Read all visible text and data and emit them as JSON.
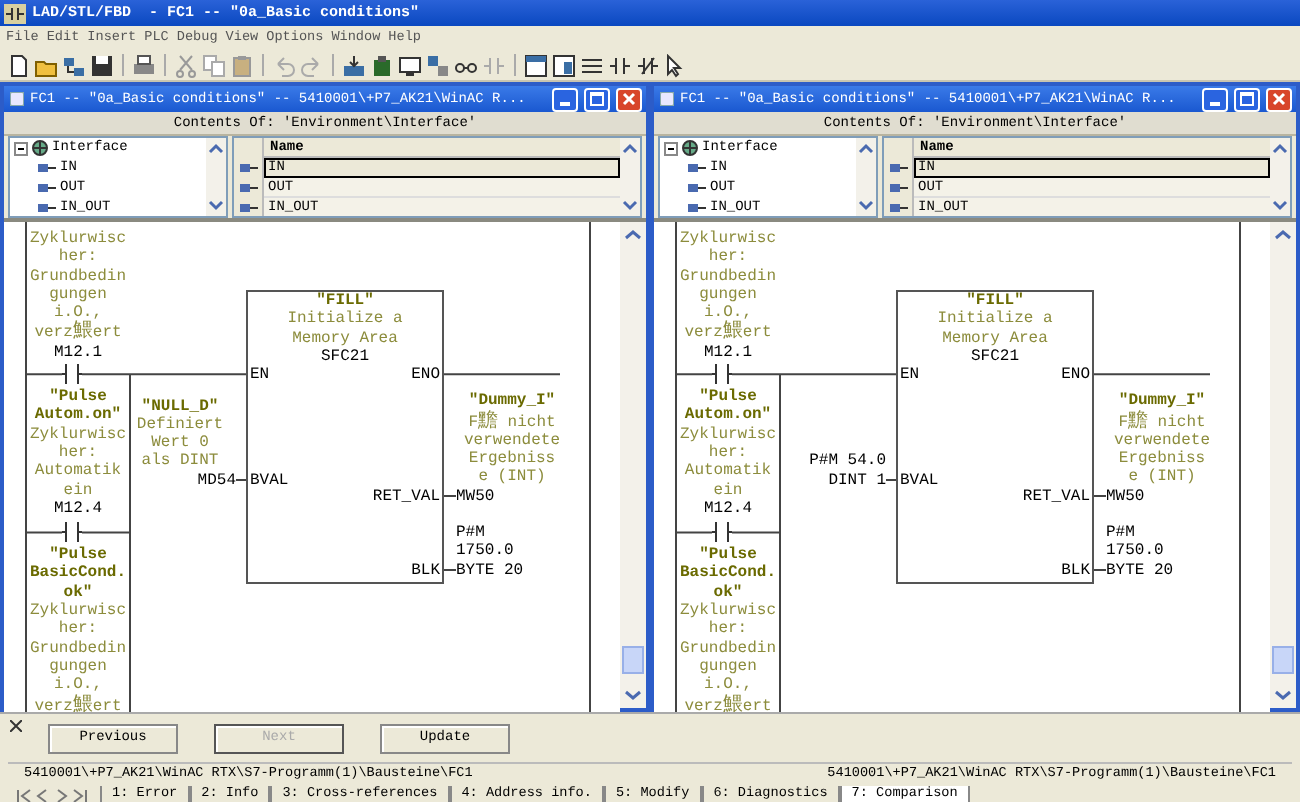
{
  "app_title": "LAD/STL/FBD  - FC1 -- \"0a_Basic conditions\"",
  "menu": [
    "File",
    "Edit",
    "Insert",
    "PLC",
    "Debug",
    "View",
    "Options",
    "Window",
    "Help"
  ],
  "windows": [
    {
      "title": "FC1 -- \"0a_Basic conditions\" -- 5410001\\+P7_AK21\\WinAC R...",
      "contents_of": "Contents Of: 'Environment\\Interface'",
      "tree": {
        "label": "Interface",
        "expanded": true,
        "children": [
          {
            "label": "IN"
          },
          {
            "label": "OUT"
          },
          {
            "label": "IN_OUT"
          }
        ]
      },
      "table": {
        "column": "Name",
        "rows": [
          {
            "name": "IN",
            "selected": true
          },
          {
            "name": "OUT",
            "selected": false
          },
          {
            "name": "IN_OUT",
            "selected": false
          }
        ]
      },
      "network": {
        "contacts": [
          {
            "comment": [
              "Zyklurwisc",
              "her:",
              "Grundbedin",
              "gungen",
              "i.O.,",
              "verz鰃ert"
            ],
            "address": "M12.1"
          },
          {
            "symbol": [
              "\"Pulse",
              "Autom.on\""
            ],
            "comment": [
              "Zyklurwisc",
              "her:",
              "Automatik",
              "ein"
            ],
            "address": "M12.4"
          },
          {
            "symbol": [
              "\"Pulse",
              "BasicCond.",
              "ok\""
            ],
            "comment": [
              "Zyklurwisc",
              "her:",
              "Grundbedin",
              "gungen",
              "i.O.,",
              "verz鰃ert"
            ]
          }
        ],
        "block": {
          "symbol": "\"FILL\"",
          "description": [
            "Initialize a",
            "Memory Area"
          ],
          "number": "SFC21",
          "en": "EN",
          "eno": "ENO"
        },
        "params": [
          {
            "pin": "BVAL",
            "kind": "input",
            "symbol": "\"NULL_D\"",
            "comment": [
              "Definiert",
              "Wert 0",
              "als DINT"
            ],
            "operand": [
              "MD54"
            ]
          },
          {
            "pin": "RET_VAL",
            "kind": "output",
            "symbol": "\"Dummy_I\"",
            "comment": [
              "F黵 nicht",
              "verwendete",
              "Ergebniss",
              "e (INT)"
            ],
            "operand": [
              "MW50"
            ]
          },
          {
            "pin": "BLK",
            "kind": "output",
            "operand": [
              "P#M",
              "1750.0",
              "BYTE 20"
            ]
          }
        ]
      }
    },
    {
      "title": "FC1 -- \"0a_Basic conditions\" -- 5410001\\+P7_AK21\\WinAC R...",
      "contents_of": "Contents Of: 'Environment\\Interface'",
      "tree": {
        "label": "Interface",
        "expanded": true,
        "children": [
          {
            "label": "IN"
          },
          {
            "label": "OUT"
          },
          {
            "label": "IN_OUT"
          }
        ]
      },
      "table": {
        "column": "Name",
        "rows": [
          {
            "name": "IN",
            "selected": true
          },
          {
            "name": "OUT",
            "selected": false
          },
          {
            "name": "IN_OUT",
            "selected": false
          }
        ]
      },
      "network": {
        "contacts": [
          {
            "comment": [
              "Zyklurwisc",
              "her:",
              "Grundbedin",
              "gungen",
              "i.O.,",
              "verz鰃ert"
            ],
            "address": "M12.1"
          },
          {
            "symbol": [
              "\"Pulse",
              "Autom.on\""
            ],
            "comment": [
              "Zyklurwisc",
              "her:",
              "Automatik",
              "ein"
            ],
            "address": "M12.4"
          },
          {
            "symbol": [
              "\"Pulse",
              "BasicCond.",
              "ok\""
            ],
            "comment": [
              "Zyklurwisc",
              "her:",
              "Grundbedin",
              "gungen",
              "i.O.,",
              "verz鰃ert"
            ]
          }
        ],
        "block": {
          "symbol": "\"FILL\"",
          "description": [
            "Initialize a",
            "Memory Area"
          ],
          "number": "SFC21",
          "en": "EN",
          "eno": "ENO"
        },
        "params": [
          {
            "pin": "BVAL",
            "kind": "input",
            "operand": [
              "P#M 54.0",
              "DINT 1"
            ]
          },
          {
            "pin": "RET_VAL",
            "kind": "output",
            "symbol": "\"Dummy_I\"",
            "comment": [
              "F黵 nicht",
              "verwendete",
              "Ergebniss",
              "e (INT)"
            ],
            "operand": [
              "MW50"
            ]
          },
          {
            "pin": "BLK",
            "kind": "output",
            "operand": [
              "P#M",
              "1750.0",
              "BYTE 20"
            ]
          }
        ]
      }
    }
  ],
  "bottom_panel": {
    "buttons": [
      {
        "label": "Previous",
        "disabled": false
      },
      {
        "label": "Next",
        "disabled": true
      },
      {
        "label": "Update",
        "disabled": false
      }
    ],
    "paths": [
      "5410001\\+P7_AK21\\WinAC RTX\\S7-Programm(1)\\Bausteine\\FC1",
      "5410001\\+P7_AK21\\WinAC RTX\\S7-Programm(1)\\Bausteine\\FC1"
    ],
    "tabs": [
      {
        "label": "1: Error",
        "selected": false
      },
      {
        "label": "2: Info",
        "selected": false
      },
      {
        "label": "3: Cross-references",
        "selected": false
      },
      {
        "label": "4: Address info.",
        "selected": false
      },
      {
        "label": "5: Modify",
        "selected": false
      },
      {
        "label": "6: Diagnostics",
        "selected": false
      },
      {
        "label": "7: Comparison",
        "selected": true
      }
    ]
  }
}
